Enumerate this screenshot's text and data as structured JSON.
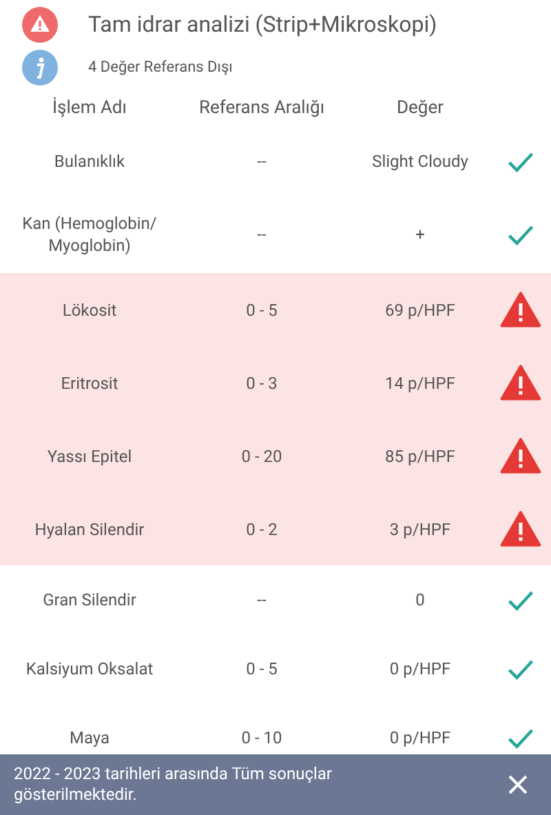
{
  "header": {
    "title": "Tam idrar analizi (Strip+Mikroskopi)",
    "summary": "4 Değer Referans Dışı"
  },
  "table": {
    "columns": [
      "İşlem Adı",
      "Referans Aralığı",
      "Değer"
    ],
    "rows": [
      {
        "name": "Bulanıklık",
        "reference": "--",
        "value": "Slight Cloudy",
        "out_of_range": false
      },
      {
        "name": "Kan (Hemoglobin/ Myoglobin)",
        "reference": "--",
        "value": "+",
        "out_of_range": false
      },
      {
        "name": "Lökosit",
        "reference": "0 - 5",
        "value": "69 p/HPF",
        "out_of_range": true
      },
      {
        "name": "Eritrosit",
        "reference": "0 - 3",
        "value": "14 p/HPF",
        "out_of_range": true
      },
      {
        "name": "Yassı Epitel",
        "reference": "0 - 20",
        "value": "85 p/HPF",
        "out_of_range": true
      },
      {
        "name": "Hyalan Silendir",
        "reference": "0 - 2",
        "value": "3 p/HPF",
        "out_of_range": true
      },
      {
        "name": "Gran Silendir",
        "reference": "--",
        "value": "0",
        "out_of_range": false
      },
      {
        "name": "Kalsiyum Oksalat",
        "reference": "0 - 5",
        "value": "0 p/HPF",
        "out_of_range": false
      },
      {
        "name": "Maya",
        "reference": "0 - 10",
        "value": "0 p/HPF",
        "out_of_range": false
      }
    ]
  },
  "banner": {
    "message": "2022 - 2023 tarihleri arasında Tüm sonuçlar gösterilmektedir."
  }
}
